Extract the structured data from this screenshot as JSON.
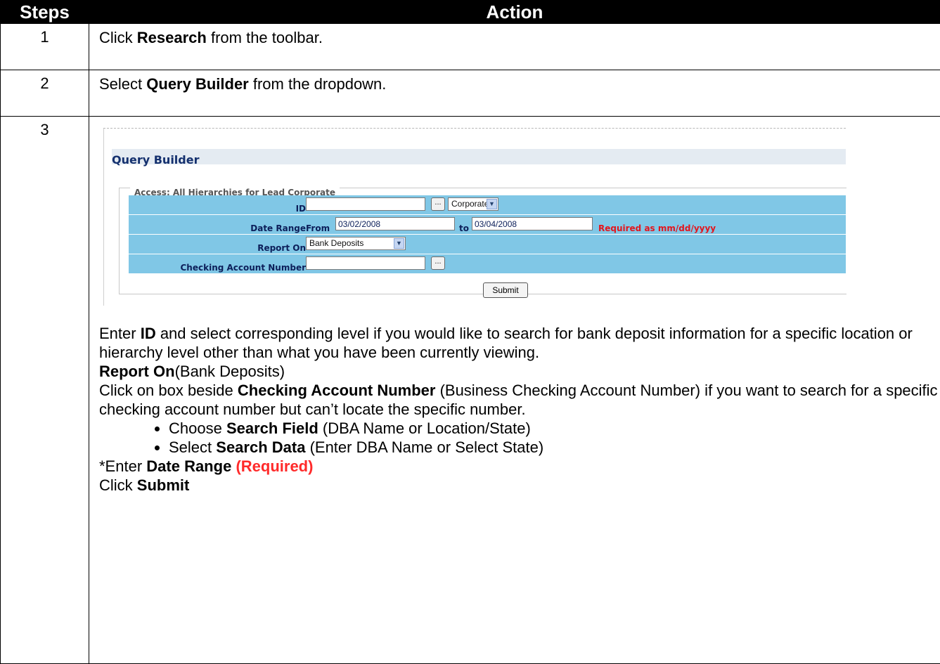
{
  "table": {
    "header_steps": "Steps",
    "header_action": "Action",
    "rows": [
      {
        "num": "1",
        "pre": "Click ",
        "bold": "Research",
        "post": " from the toolbar."
      },
      {
        "num": "2",
        "pre": "Select ",
        "bold": "Query Builder",
        "post": " from the dropdown."
      },
      {
        "num": "3"
      }
    ]
  },
  "screenshot": {
    "title": "Query Builder",
    "legend": "Access: All Hierarchies for Lead Corporate",
    "fields": {
      "id_label": "ID",
      "id_value": "",
      "browse_label": "...",
      "level_value": "Corporate",
      "date_label": "Date Range",
      "from_label": "From",
      "from_value": "03/02/2008",
      "to_label": "to",
      "to_value": "03/04/2008",
      "required_note": "Required as mm/dd/yyyy",
      "report_label": "Report On",
      "report_value": "Bank Deposits",
      "checking_label": "Checking Account Number",
      "checking_value": ""
    },
    "submit_label": "Submit"
  },
  "instructions": {
    "p1_pre": "Enter ",
    "p1_bold": "ID",
    "p1_post": " and select corresponding level if you would like to search for bank deposit information for a specific location or hierarchy level other than what you have been currently viewing.",
    "p2_bold": "Report On",
    "p2_post": "(Bank Deposits)",
    "p3_pre": "Click on box beside ",
    "p3_bold": "Checking Account Number",
    "p3_post": " (Business Checking Account Number) if you want to search for a specific checking account number but can’t locate the specific number.",
    "bullet1_pre": "Choose ",
    "bullet1_bold": "Search Field",
    "bullet1_post": " (DBA Name or Location/State)",
    "bullet2_pre": "Select ",
    "bullet2_bold": "Search Data",
    "bullet2_post": " (Enter DBA Name or Select State)",
    "p4_pre": "*Enter ",
    "p4_bold": "Date Range",
    "p4_red": "(Required)",
    "p5_pre": "Click ",
    "p5_bold": "Submit"
  },
  "colors": {
    "header_bg": "#000000",
    "form_row_bg": "#80c7e6",
    "title_blue": "#14306e",
    "required_red": "#e3151d"
  }
}
